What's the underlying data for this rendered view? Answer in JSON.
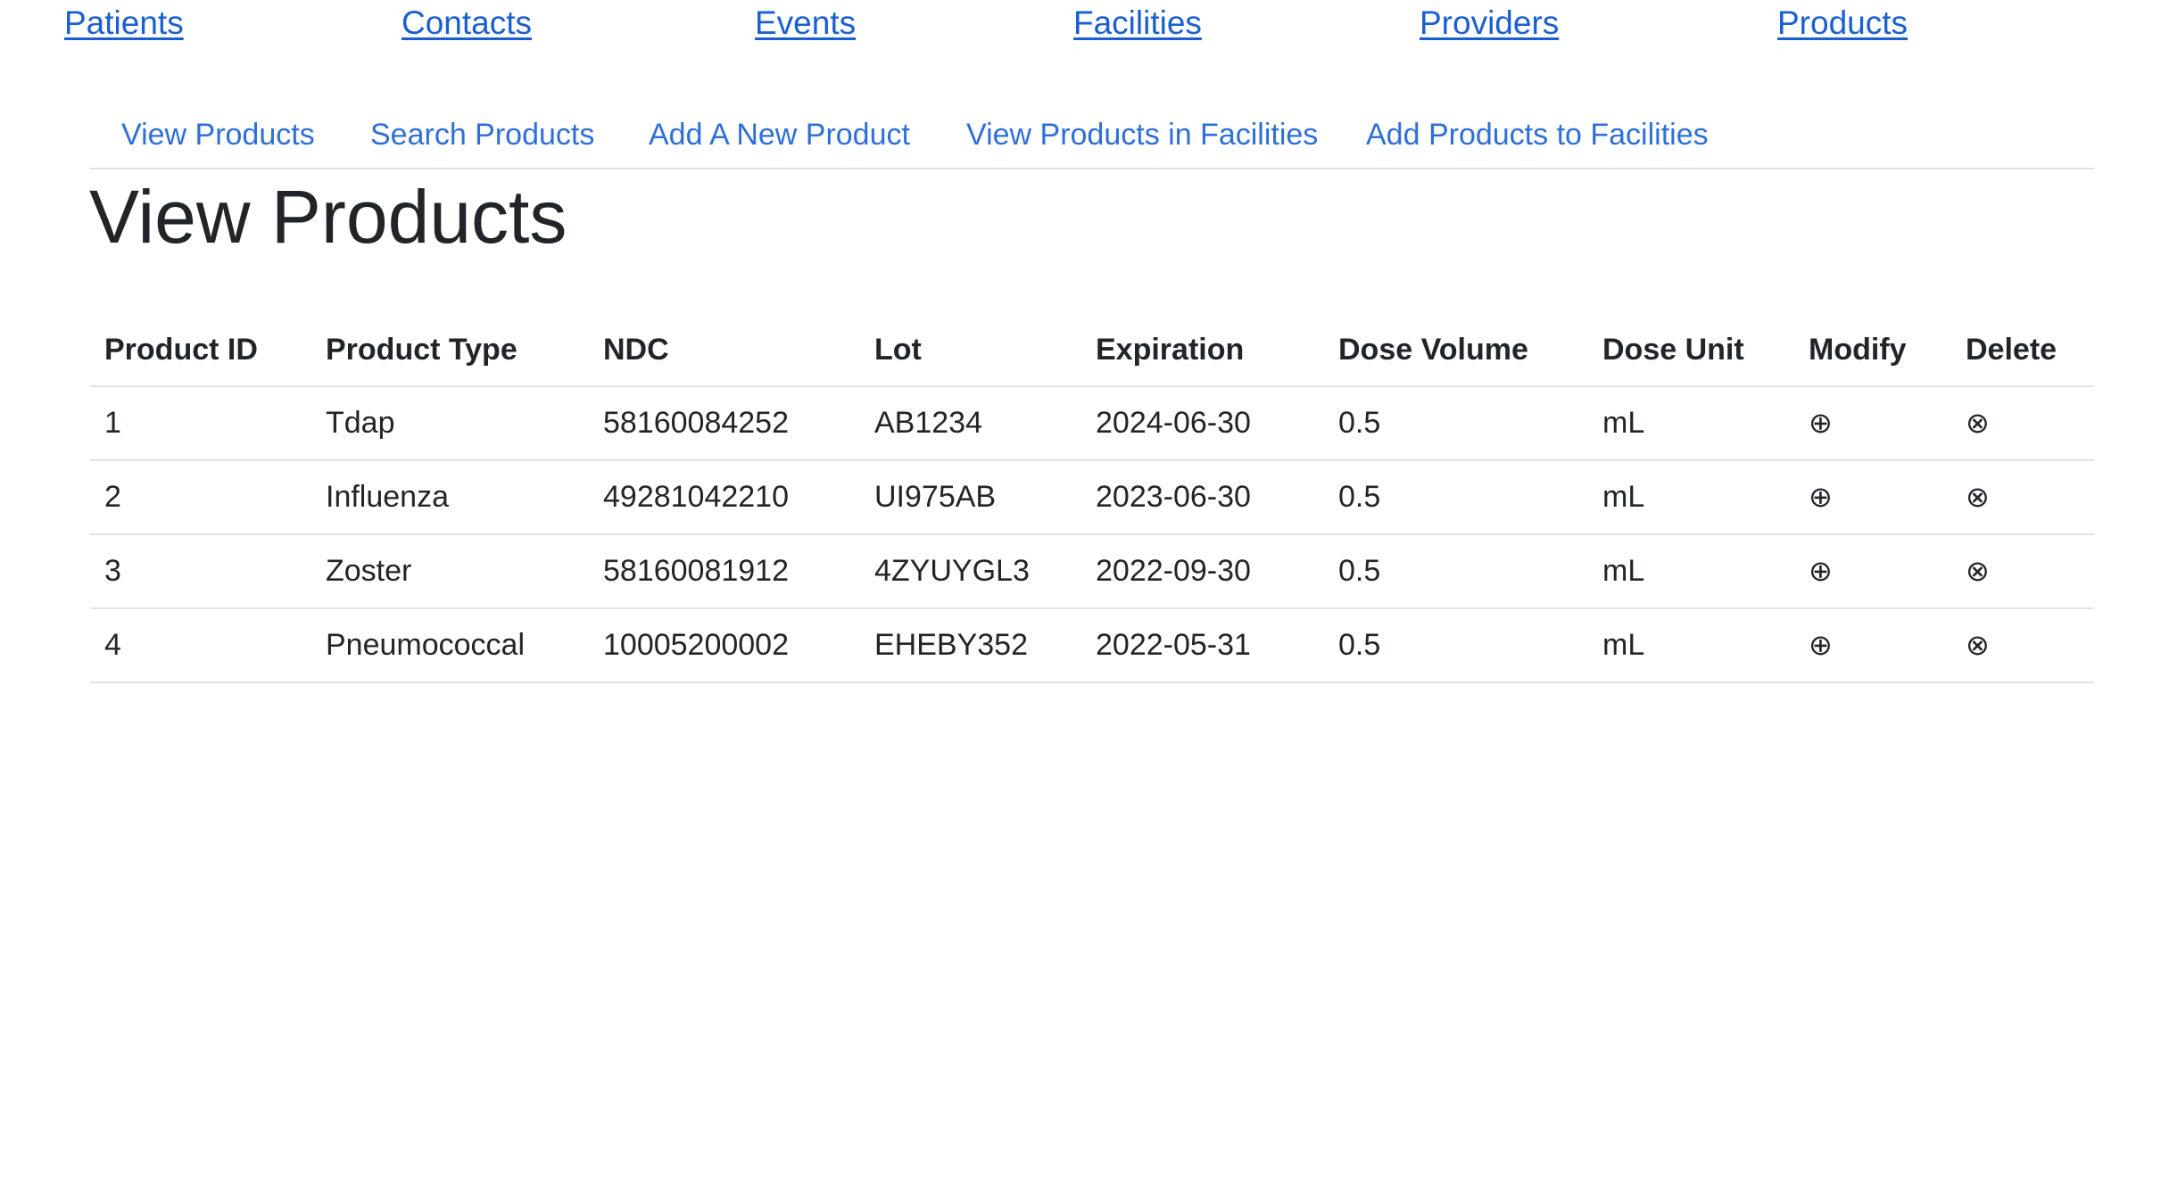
{
  "top_nav": {
    "patients": "Patients",
    "contacts": "Contacts",
    "events": "Events",
    "facilities": "Facilities",
    "providers": "Providers",
    "products": "Products"
  },
  "sub_nav": {
    "view_products": "View Products",
    "search_products": "Search Products",
    "add_product": "Add A New Product",
    "view_products_in_facilities": "View Products in Facilities",
    "add_products_to_facilities": "Add Products to Facilities"
  },
  "page_title": "View Products",
  "table": {
    "headers": {
      "product_id": "Product ID",
      "product_type": "Product Type",
      "ndc": "NDC",
      "lot": "Lot",
      "expiration": "Expiration",
      "dose_volume": "Dose Volume",
      "dose_unit": "Dose Unit",
      "modify": "Modify",
      "delete": "Delete"
    },
    "rows": [
      {
        "id": "1",
        "type": "Tdap",
        "ndc": "58160084252",
        "lot": "AB1234",
        "expiration": "2024-06-30",
        "dose_volume": "0.5",
        "dose_unit": "mL",
        "modify_icon": "⊕",
        "delete_icon": "⊗"
      },
      {
        "id": "2",
        "type": "Influenza",
        "ndc": "49281042210",
        "lot": "UI975AB",
        "expiration": "2023-06-30",
        "dose_volume": "0.5",
        "dose_unit": "mL",
        "modify_icon": "⊕",
        "delete_icon": "⊗"
      },
      {
        "id": "3",
        "type": "Zoster",
        "ndc": "58160081912",
        "lot": "4ZYUYGL3",
        "expiration": "2022-09-30",
        "dose_volume": "0.5",
        "dose_unit": "mL",
        "modify_icon": "⊕",
        "delete_icon": "⊗"
      },
      {
        "id": "4",
        "type": "Pneumococcal",
        "ndc": "10005200002",
        "lot": "EHEBY352",
        "expiration": "2022-05-31",
        "dose_volume": "0.5",
        "dose_unit": "mL",
        "modify_icon": "⊕",
        "delete_icon": "⊗"
      }
    ]
  },
  "colors": {
    "top_nav_link": "#1a5fd0",
    "sub_nav_link": "#2f6fd8",
    "text": "#212529",
    "border": "#dee2e6"
  },
  "icons": {
    "modify": "circled-plus-icon",
    "delete": "circled-times-icon"
  }
}
